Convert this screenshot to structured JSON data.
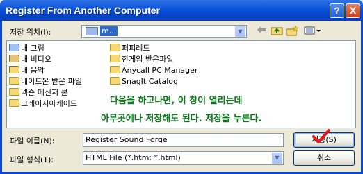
{
  "window": {
    "title": "Register From Another Computer"
  },
  "title_buttons": {
    "help": "?",
    "close": "X"
  },
  "save_in": {
    "label": "저장 위치(I):",
    "value": "m..."
  },
  "toolbar": {
    "back_icon": "back-arrow-icon",
    "up_icon": "up-folder-icon",
    "new_folder_icon": "new-folder-icon",
    "views_icon": "views-menu-icon"
  },
  "files": [
    {
      "name": "내 그림",
      "icon": "my-pictures-icon"
    },
    {
      "name": "내 비디오",
      "icon": "my-videos-icon"
    },
    {
      "name": "내 음악",
      "icon": "my-music-icon"
    },
    {
      "name": "네이트온 받은 파일",
      "icon": "folder-icon"
    },
    {
      "name": "넥슨 메신저 콘",
      "icon": "folder-icon"
    },
    {
      "name": "크레이지아케이드",
      "icon": "folder-icon"
    },
    {
      "name": "퍼피레드",
      "icon": "folder-icon"
    },
    {
      "name": "한게임 받은파일",
      "icon": "folder-icon"
    },
    {
      "name": "Anycall PC Manager",
      "icon": "folder-icon"
    },
    {
      "name": "SnagIt Catalog",
      "icon": "folder-icon"
    }
  ],
  "annotation": {
    "line1": "다음을 하고나면, 이 창이 열리는데",
    "line2": "아무곳에나 저장해도 된다. 저장을 누른다."
  },
  "filename": {
    "label": "파일 이름(N):",
    "value": "Register Sound Forge"
  },
  "filetype": {
    "label": "파일 형식(T):",
    "value": "HTML File (*.htm; *.html)"
  },
  "buttons": {
    "save": "저장(S)",
    "cancel": "취소"
  },
  "colors": {
    "title_bar": "#0a52d8",
    "annotation": "#0a7a1c",
    "checkmark": "#e01818"
  }
}
